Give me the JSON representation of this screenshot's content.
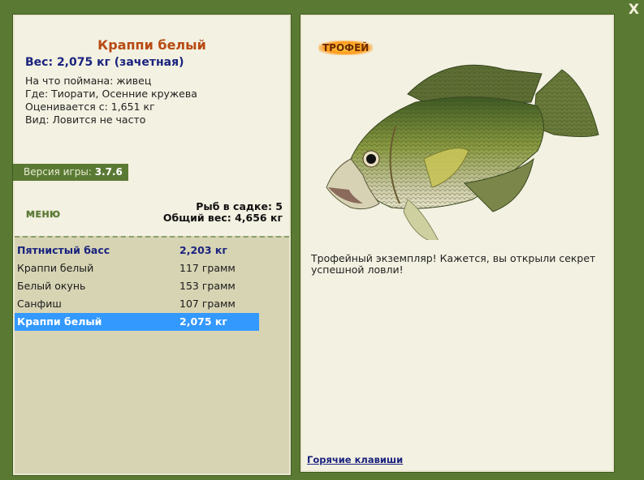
{
  "window": {
    "close_label": "X"
  },
  "fish": {
    "name": "Краппи белый",
    "weight_line": "Вес: 2,075 кг (зачетная)",
    "info": [
      "На что поймана: живец",
      "Где: Тиорати, Осенние кружева",
      "Оценивается с: 1,651 кг",
      "Вид: Ловится не часто"
    ]
  },
  "version": {
    "label": "Версия игры:",
    "value": "3.7.6"
  },
  "menu_label": "МЕНЮ",
  "stats": {
    "fish_count": "Рыб в садке: 5",
    "total_weight": "Общий вес: 4,656 кг"
  },
  "catch_list": [
    {
      "name": "Пятнистый басс",
      "weight": "2,203 кг"
    },
    {
      "name": "Краппи белый",
      "weight": "117 грамм"
    },
    {
      "name": "Белый окунь",
      "weight": "153 грамм"
    },
    {
      "name": "Санфиш",
      "weight": "107 грамм"
    },
    {
      "name": "Краппи белый",
      "weight": "2,075 кг"
    }
  ],
  "trophy_badge": "ТРОФЕЙ",
  "description": "Трофейный экземпляр! Кажется, вы открыли секрет успешной ловли!",
  "hotkeys_link": "Горячие клавиши",
  "colors": {
    "background": "#5a7a34",
    "panel": "#f3f1e1",
    "selected": "#3399ff",
    "fish_name": "#b84a12"
  }
}
